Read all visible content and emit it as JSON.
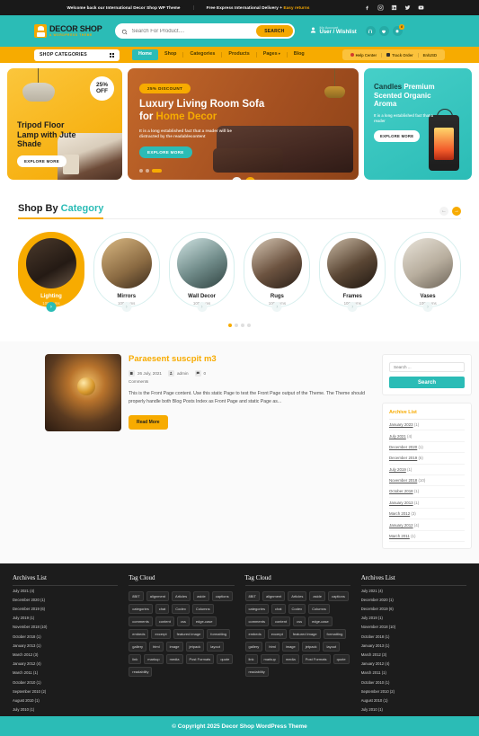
{
  "topbar": {
    "message1": "Welcome back our International Decor Shop WP Theme",
    "message2_main": "Free Express International Delivery + ",
    "message2_highlight": "Easy returns",
    "social": [
      "facebook-icon",
      "instagram-icon",
      "linkedin-icon",
      "twitter-icon",
      "youtube-icon"
    ]
  },
  "header": {
    "logo_name": "DECOR SHOP",
    "logo_sub": "A WORDPRESS THEME",
    "search_placeholder": "Search For Product....",
    "search_value": "",
    "search_button": "SEARCH",
    "account_top": "My Account",
    "account_main": "User / Wishlist",
    "cart_count": "0"
  },
  "nav": {
    "shop_categories": "SHOP CATEGORIES",
    "links": [
      {
        "label": "Home",
        "active": true
      },
      {
        "label": "Shop",
        "active": false
      },
      {
        "label": "Categories",
        "active": false
      },
      {
        "label": "Products",
        "active": false
      },
      {
        "label": "Pages",
        "active": false,
        "caret": true
      },
      {
        "label": "Blog",
        "active": false
      }
    ],
    "right": [
      {
        "label": "Help Center"
      },
      {
        "label": "Track Order"
      },
      {
        "label": "En/USD"
      }
    ]
  },
  "hero": {
    "left": {
      "badge_pct": "25%",
      "badge_off": "OFF",
      "title": "Tripod Floor Lamp with Jute Shade",
      "button": "EXPLORE MORE"
    },
    "center": {
      "pill": "25% DISCOUNT",
      "title_white": "Luxury Living Room Sofa",
      "title_for": "for ",
      "title_yellow": "Home Decor",
      "desc": "It is a long established fact that a reader will be distracted by the readablecontent",
      "button": "EXPLORE MORE"
    },
    "right": {
      "title_dark": "Candles ",
      "title_white": "Premium Scented Organic Aroma",
      "desc": "It is a long established fact that a reader",
      "button": "EXPLORE MORE"
    }
  },
  "category_section": {
    "title_dark": "Shop By ",
    "title_teal": "Category",
    "cards": [
      {
        "name": "Lighting",
        "items": "100 Items",
        "active": true
      },
      {
        "name": "Mirrors",
        "items": "100 Items",
        "active": false
      },
      {
        "name": "Wall Decor",
        "items": "100 Items",
        "active": false
      },
      {
        "name": "Rugs",
        "items": "100 Items",
        "active": false
      },
      {
        "name": "Frames",
        "items": "100 Items",
        "active": false
      },
      {
        "name": "Vases",
        "items": "100 Items",
        "active": false
      }
    ],
    "dots": 4,
    "active_dot": 0
  },
  "blog": {
    "post_title": "Paraesent suscpit m3",
    "date": "26 July, 2021",
    "author": "admin",
    "comment_count": "0",
    "comments_label": "Comments",
    "excerpt": "This is the Front Page content. Use this static Page to test the Front Page output of the Theme. The Theme should properly handle both Blog Posts Index as Front Page and static Page as...",
    "read_more": "Read More"
  },
  "sidebar": {
    "search_placeholder": "Search ...",
    "search_value": "",
    "search_button": "Search",
    "archives_title": "Archive List",
    "archives": [
      {
        "label": "January 2023",
        "count": "(1)"
      },
      {
        "label": "July 2021",
        "count": "(4)"
      },
      {
        "label": "December 2020",
        "count": "(1)"
      },
      {
        "label": "December 2019",
        "count": "(6)"
      },
      {
        "label": "July 2019",
        "count": "(1)"
      },
      {
        "label": "November 2018",
        "count": "(10)"
      },
      {
        "label": "October 2018",
        "count": "(1)"
      },
      {
        "label": "January 2013",
        "count": "(1)"
      },
      {
        "label": "March 2012",
        "count": "(3)"
      },
      {
        "label": "January 2012",
        "count": "(4)"
      },
      {
        "label": "March 2011",
        "count": "(1)"
      }
    ]
  },
  "footer": {
    "columns": [
      {
        "type": "archives",
        "title": "Archives List",
        "items": [
          "July 2021 (4)",
          "December 2020 (1)",
          "December 2019 (6)",
          "July 2019 (1)",
          "November 2018 (10)",
          "October 2018 (1)",
          "January 2013 (1)",
          "March 2012 (3)",
          "January 2012 (4)",
          "March 2011 (1)",
          "October 2010 (1)",
          "September 2010 (2)",
          "August 2010 (1)",
          "July 2010 (1)"
        ]
      },
      {
        "type": "tags",
        "title": "Tag Cloud",
        "items": [
          "8BIT",
          "alignment",
          "Articles",
          "aside",
          "captions",
          "categories",
          "chat",
          "Codex",
          "Columns",
          "comments",
          "content",
          "css",
          "edge-case",
          "embeds",
          "excerpt",
          "featured image",
          "formatting",
          "gallery",
          "html",
          "image",
          "jetpack",
          "layout",
          "link",
          "markup",
          "media",
          "Post Formats",
          "quote",
          "readability"
        ]
      },
      {
        "type": "tags",
        "title": "Tag Cloud",
        "items": [
          "8BIT",
          "alignment",
          "Articles",
          "aside",
          "captions",
          "categories",
          "chat",
          "Codex",
          "Columns",
          "comments",
          "content",
          "css",
          "edge-case",
          "embeds",
          "excerpt",
          "featured image",
          "formatting",
          "gallery",
          "html",
          "image",
          "jetpack",
          "layout",
          "link",
          "markup",
          "media",
          "Post Formats",
          "quote",
          "readability"
        ]
      },
      {
        "type": "archives",
        "title": "Archives List",
        "items": [
          "July 2021 (4)",
          "December 2020 (1)",
          "December 2019 (6)",
          "July 2019 (1)",
          "November 2018 (10)",
          "October 2018 (1)",
          "January 2013 (1)",
          "March 2012 (3)",
          "January 2012 (4)",
          "March 2011 (1)",
          "October 2010 (1)",
          "September 2010 (2)",
          "August 2010 (1)",
          "July 2010 (1)"
        ]
      }
    ],
    "copyright": "© Copyright 2025 Decor Shop WordPress Theme"
  },
  "colors": {
    "teal": "#2bbcb6",
    "yellow": "#f7ab00",
    "dark": "#1c1c1c"
  }
}
